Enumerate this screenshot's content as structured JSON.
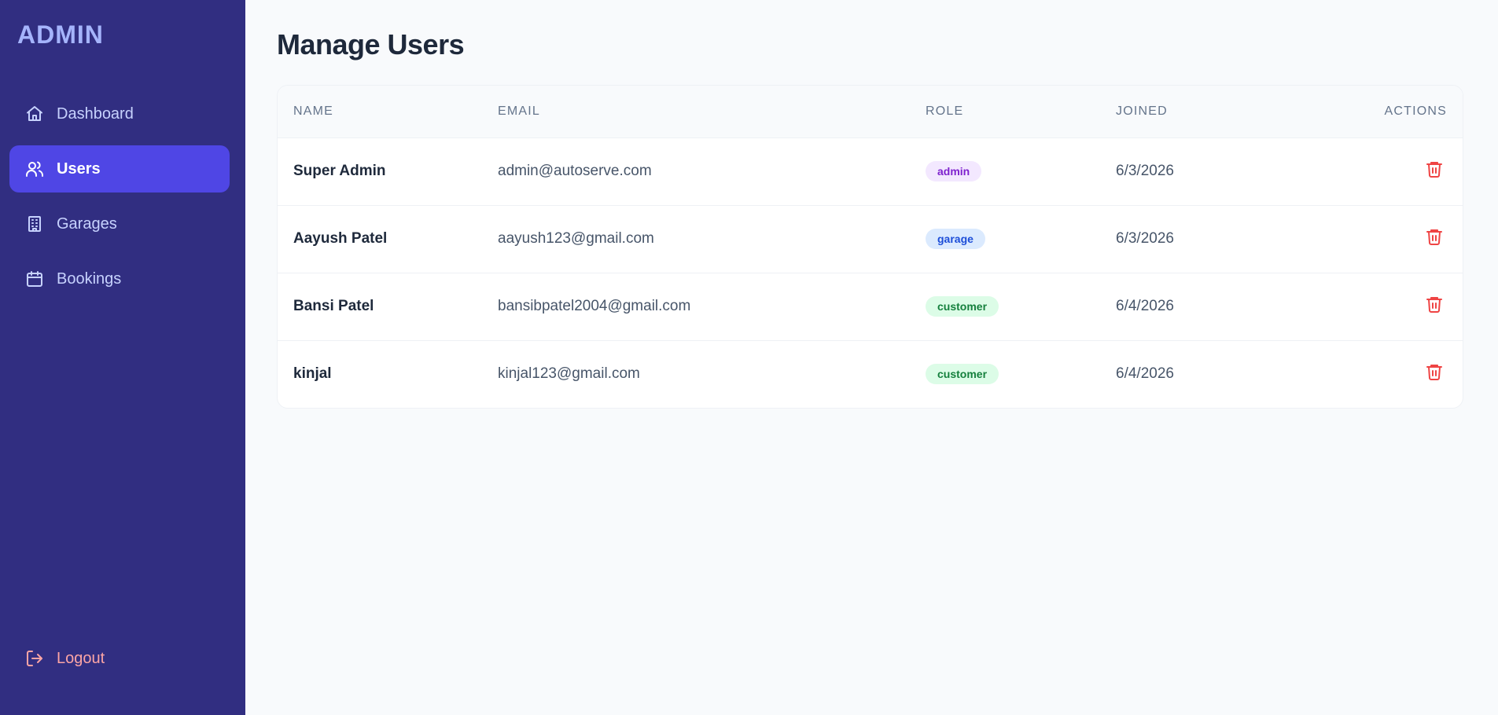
{
  "brand": "ADMIN",
  "nav": [
    {
      "label": "Dashboard",
      "icon": "home-icon"
    },
    {
      "label": "Users",
      "icon": "users-icon",
      "active": true
    },
    {
      "label": "Garages",
      "icon": "building-icon"
    },
    {
      "label": "Bookings",
      "icon": "calendar-icon"
    }
  ],
  "logout_label": "Logout",
  "page_title": "Manage Users",
  "table": {
    "headers": {
      "name": "NAME",
      "email": "EMAIL",
      "role": "ROLE",
      "joined": "JOINED",
      "actions": "ACTIONS"
    },
    "rows": [
      {
        "name": "Super Admin",
        "email": "admin@autoserve.com",
        "role": "admin",
        "joined": "6/3/2026"
      },
      {
        "name": "Aayush Patel",
        "email": "aayush123@gmail.com",
        "role": "garage",
        "joined": "6/3/2026"
      },
      {
        "name": "Bansi Patel",
        "email": "bansibpatel2004@gmail.com",
        "role": "customer",
        "joined": "6/4/2026"
      },
      {
        "name": "kinjal",
        "email": "kinjal123@gmail.com",
        "role": "customer",
        "joined": "6/4/2026"
      }
    ]
  },
  "colors": {
    "sidebar_bg": "#312e81",
    "active_item": "#4f46e5",
    "brand_text": "#a5b4fc",
    "logout_text": "#fca5a5",
    "delete_icon": "#ef4444"
  }
}
